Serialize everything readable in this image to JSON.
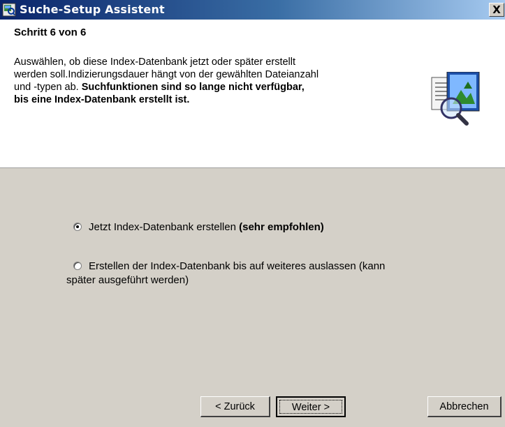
{
  "window": {
    "title": "Suche-Setup Assistent",
    "close_label": "X"
  },
  "header": {
    "step_title": "Schritt 6 von 6",
    "desc_line1": "Auswählen, ob diese Index-Datenbank jetzt oder später erstellt",
    "desc_line2": "werden soll.Indizierungsdauer hängt von der gewählten Dateianzahl",
    "desc_line3_plain": "und -typen ab. ",
    "desc_line3_bold": "Suchfunktionen sind so lange nicht verfügbar,",
    "desc_line4_bold": "bis eine Index-Datenbank erstellt ist.",
    "icon": "search-document-icon"
  },
  "options": {
    "option1_plain": "Jetzt Index-Datenbank erstellen ",
    "option1_bold": "(sehr empfohlen)",
    "option1_checked": true,
    "option2_line1": "Erstellen der Index-Datenbank bis auf weiteres auslassen (kann",
    "option2_line2": "später ausgeführt werden)",
    "option2_checked": false
  },
  "buttons": {
    "back_label": "< Zurück",
    "next_label": "Weiter >",
    "cancel_label": "Abbrechen"
  },
  "colors": {
    "title_gradient_start": "#0a246a",
    "title_gradient_end": "#a6caf0",
    "dialog_face": "#d4d0c8"
  }
}
